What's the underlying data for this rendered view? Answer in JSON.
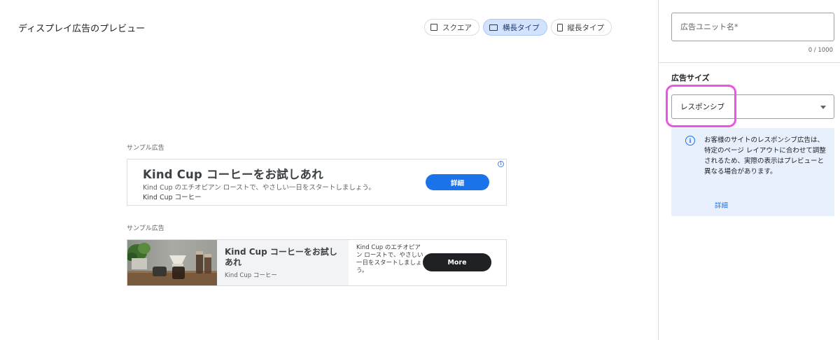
{
  "preview": {
    "title": "ディスプレイ広告のプレビュー",
    "toggles": [
      {
        "label": "スクエア",
        "icon": "square-icon",
        "active": false
      },
      {
        "label": "横長タイプ",
        "icon": "landscape-icon",
        "active": true
      },
      {
        "label": "縦長タイプ",
        "icon": "portrait-icon",
        "active": false
      }
    ],
    "ad1": {
      "sample_label": "サンプル広告",
      "headline": "Kind Cup コーヒーをお試しあれ",
      "description": "Kind Cup のエチオピアン ローストで、やさしい一日をスタートしましょう。",
      "brand": "Kind Cup コーヒー",
      "cta": "詳細"
    },
    "ad2": {
      "sample_label": "サンプル広告",
      "headline": "Kind Cup コーヒーをお試しあれ",
      "brand": "Kind Cup コーヒー",
      "description": "Kind Cup のエチオピアン ローストで、やさしい一日をスタートしましょう。",
      "cta": "More"
    }
  },
  "panel": {
    "name_placeholder": "広告ユニット名*",
    "name_value": "",
    "counter": "0 / 1000",
    "size_label": "広告サイズ",
    "size_value": "レスポンシブ",
    "info_text": "お客様のサイトのレスポンシブ広告は、特定のページ レイアウトに合わせて調整されるため、実際の表示はプレビューと異なる場合があります。",
    "learn_more": "詳細"
  },
  "colors": {
    "accent": "#1a73e8",
    "toggle_active_bg": "#d3e3fd",
    "info_bg": "#e8f0fe",
    "highlight": "#f152e6",
    "dark_button": "#202124"
  }
}
